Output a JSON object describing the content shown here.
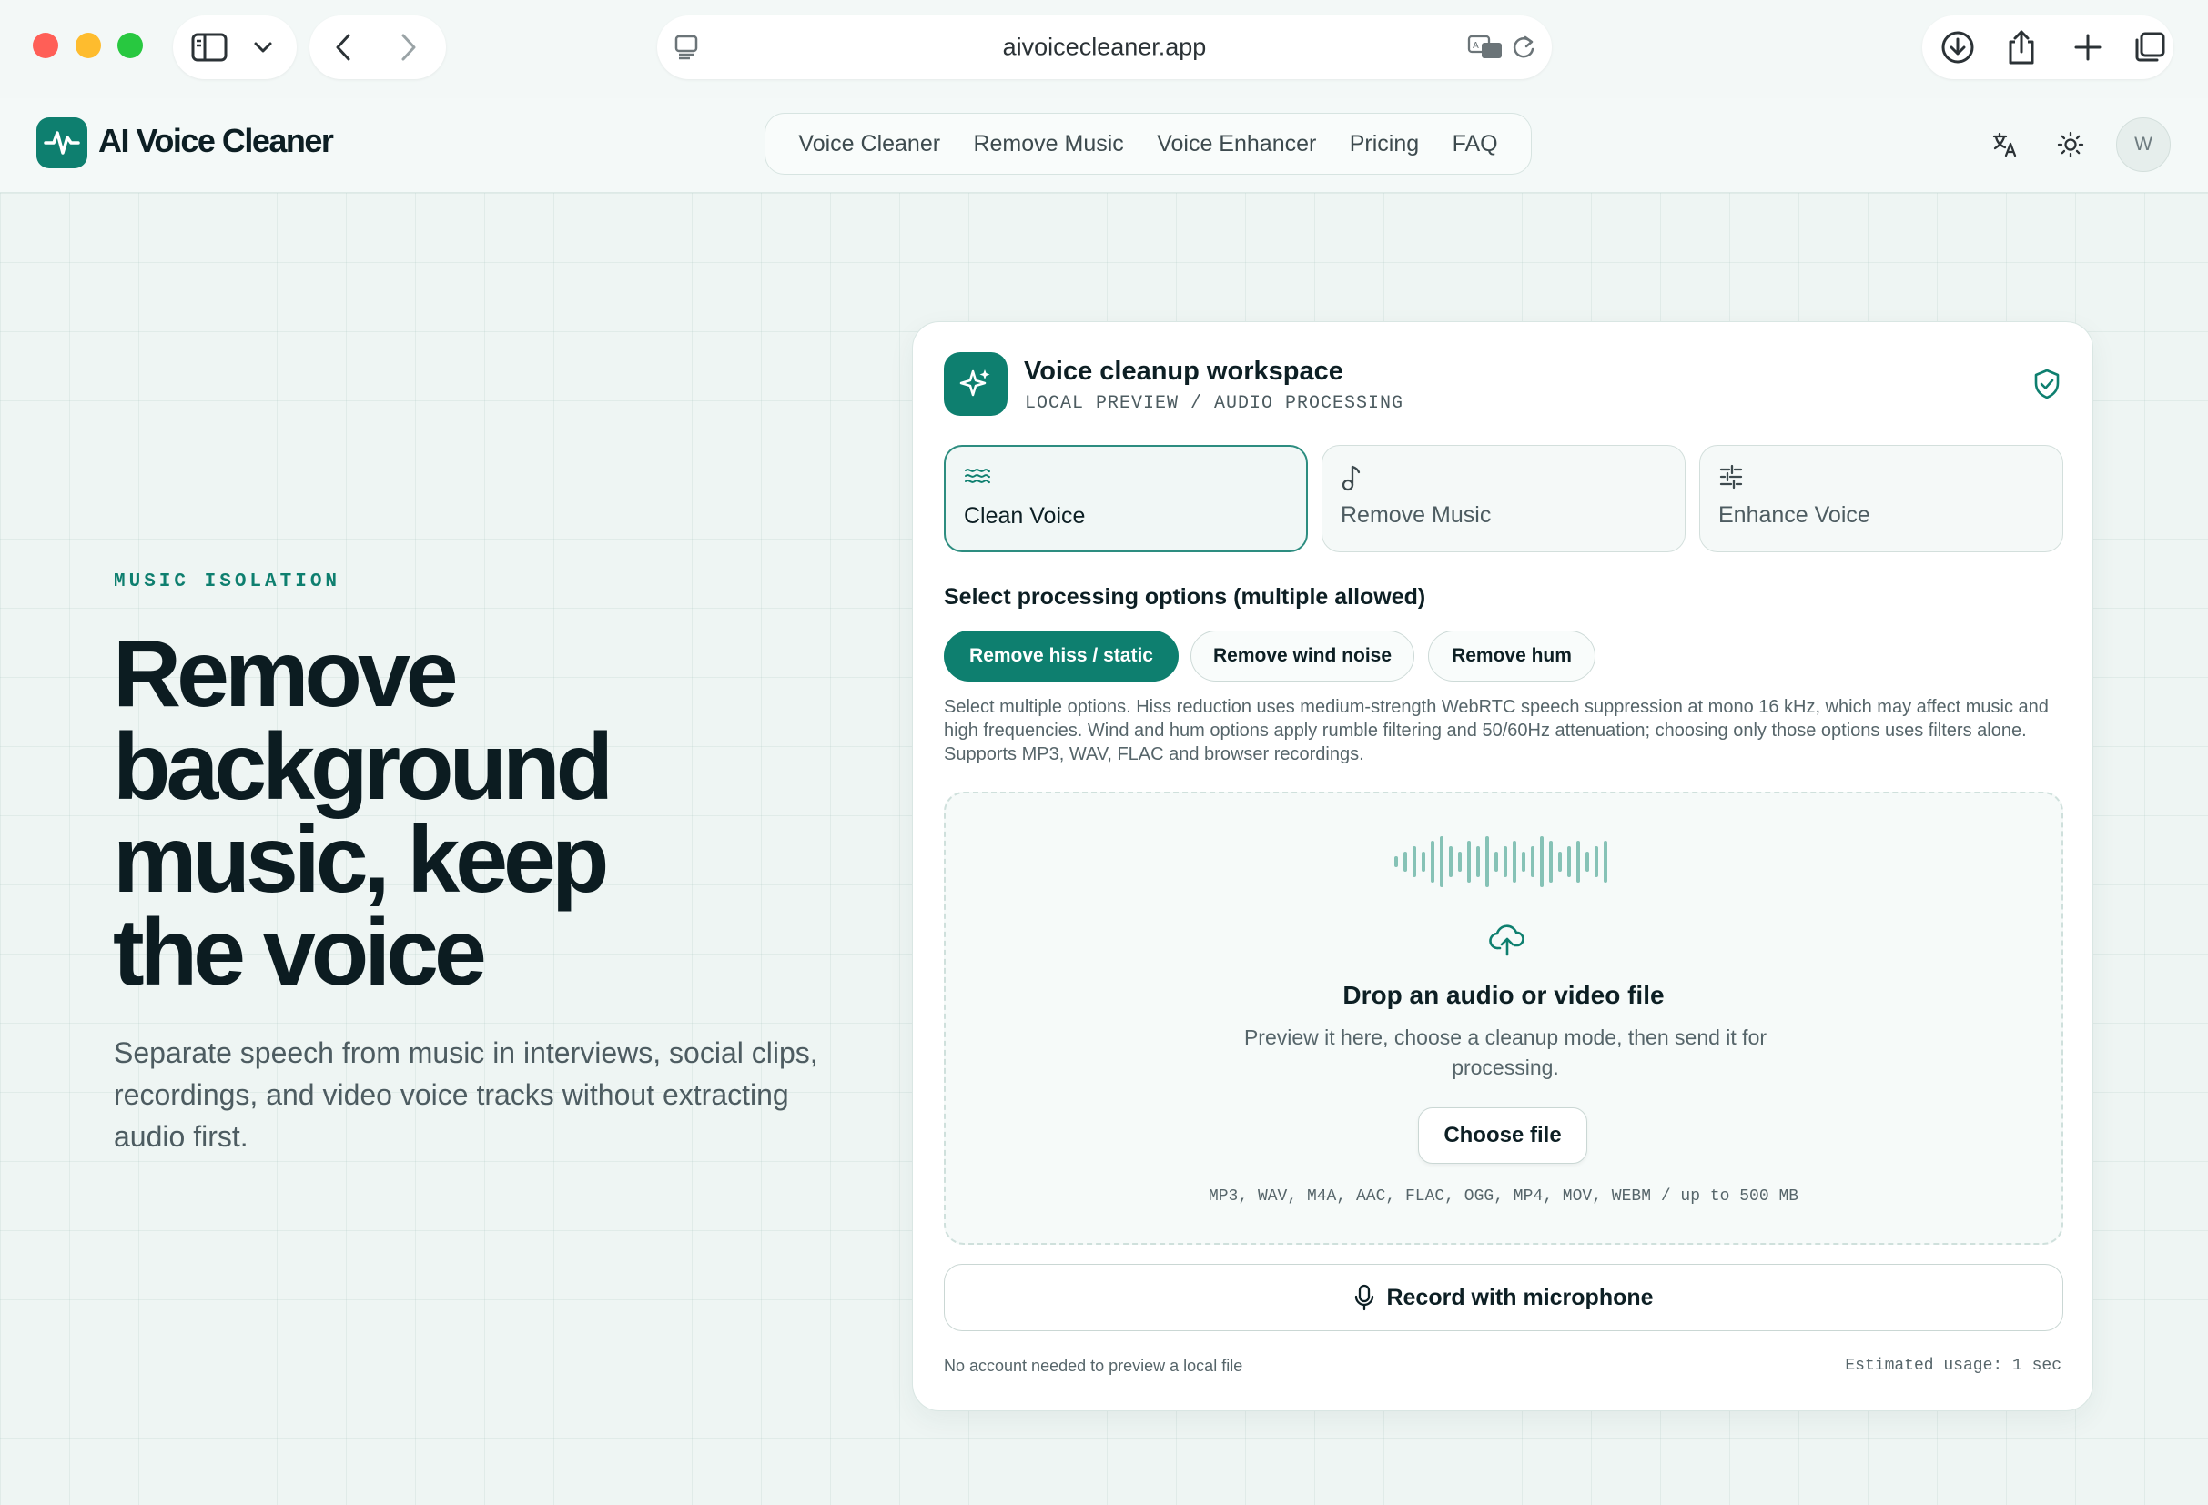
{
  "browser": {
    "url": "aivoicecleaner.app"
  },
  "header": {
    "brand": "AI Voice Cleaner",
    "nav": [
      "Voice Cleaner",
      "Remove Music",
      "Voice Enhancer",
      "Pricing",
      "FAQ"
    ],
    "avatar_initial": "W",
    "icons": [
      "translate-icon",
      "sun-icon"
    ]
  },
  "hero": {
    "eyebrow": "MUSIC ISOLATION",
    "title_lines": [
      "Remove",
      "background",
      "music, keep",
      "the voice"
    ],
    "subtitle": "Separate speech from music in interviews, social clips, recordings, and video voice tracks without extracting audio first."
  },
  "workspace": {
    "title": "Voice cleanup workspace",
    "subtitle": "LOCAL PREVIEW / AUDIO PROCESSING",
    "modes": [
      {
        "label": "Clean Voice",
        "icon": "waves-icon",
        "active": true
      },
      {
        "label": "Remove Music",
        "icon": "music-note-icon",
        "active": false
      },
      {
        "label": "Enhance Voice",
        "icon": "sliders-icon",
        "active": false
      }
    ],
    "options_title": "Select processing options (multiple allowed)",
    "options": [
      {
        "label": "Remove hiss / static",
        "selected": true
      },
      {
        "label": "Remove wind noise",
        "selected": false
      },
      {
        "label": "Remove hum",
        "selected": false
      }
    ],
    "options_description": "Select multiple options. Hiss reduction uses medium-strength WebRTC speech suppression at mono 16 kHz, which may affect music and high frequencies. Wind and hum options apply rumble filtering and 50/60Hz attenuation; choosing only those options uses filters alone. Supports MP3, WAV, FLAC and browser recordings.",
    "dropzone": {
      "title": "Drop an audio or video file",
      "subtitle": "Preview it here, choose a cleanup mode, then send it for processing.",
      "button": "Choose file",
      "formats": "MP3, WAV, M4A, AAC, FLAC, OGG, MP4, MOV, WEBM / up to 500 MB"
    },
    "record_button": "Record with microphone",
    "footer_left": "No account needed to preview a local file",
    "footer_right": "Estimated usage: 1 sec"
  },
  "colors": {
    "accent": "#0e7f6f",
    "background": "#eef5f3",
    "wave": "#86c2b6"
  }
}
